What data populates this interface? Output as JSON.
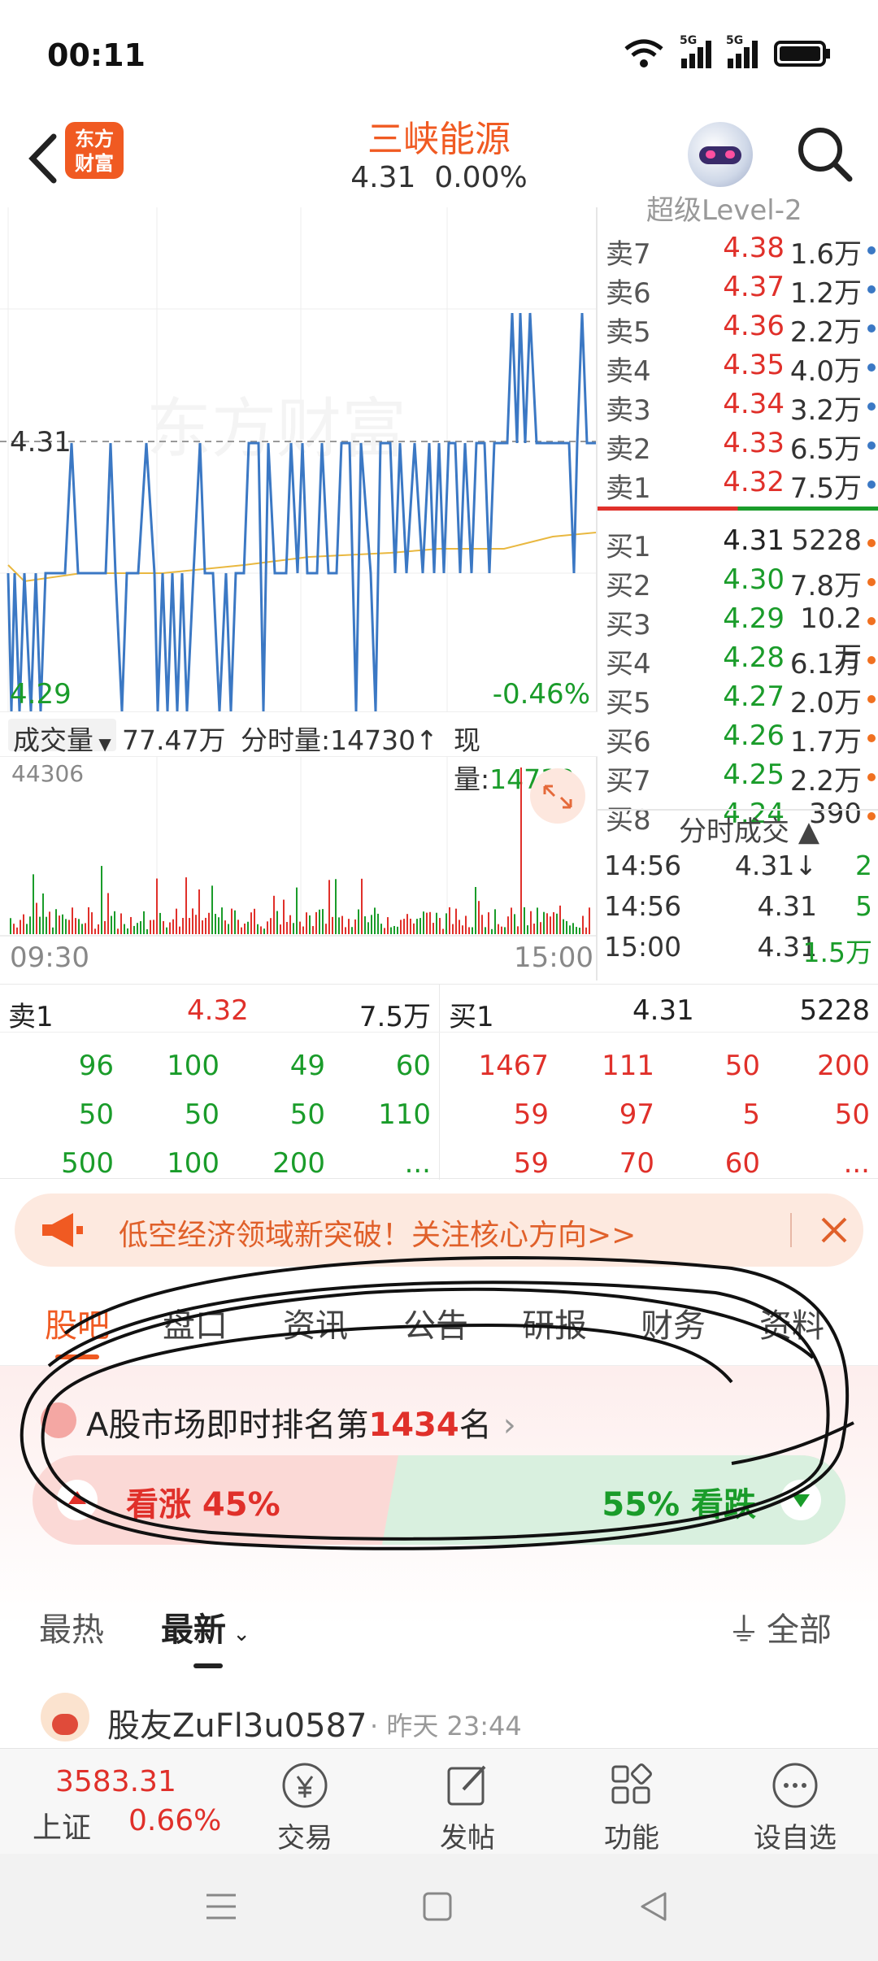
{
  "status": {
    "time": "00:11",
    "net1": "5G",
    "net2": "5G"
  },
  "header": {
    "logo_line1": "东方",
    "logo_line2": "财富",
    "stock_name": "三峡能源",
    "price": "4.31",
    "change": "0.00%"
  },
  "chart": {
    "ref_price": "4.31",
    "low_label": "4.29",
    "low_pct": "-0.46%",
    "watermark": "东方财富"
  },
  "orderbook": {
    "title": "超级Level-2",
    "sells": [
      {
        "label": "卖7",
        "price": "4.38",
        "vol": "1.6万"
      },
      {
        "label": "卖6",
        "price": "4.37",
        "vol": "1.2万"
      },
      {
        "label": "卖5",
        "price": "4.36",
        "vol": "2.2万"
      },
      {
        "label": "卖4",
        "price": "4.35",
        "vol": "4.0万"
      },
      {
        "label": "卖3",
        "price": "4.34",
        "vol": "3.2万"
      },
      {
        "label": "卖2",
        "price": "4.33",
        "vol": "6.5万"
      },
      {
        "label": "卖1",
        "price": "4.32",
        "vol": "7.5万"
      }
    ],
    "buys": [
      {
        "label": "买1",
        "price": "4.31",
        "vol": "5228"
      },
      {
        "label": "买2",
        "price": "4.30",
        "vol": "7.8万"
      },
      {
        "label": "买3",
        "price": "4.29",
        "vol": "10.2万"
      },
      {
        "label": "买4",
        "price": "4.28",
        "vol": "6.1万"
      },
      {
        "label": "买5",
        "price": "4.27",
        "vol": "2.0万"
      },
      {
        "label": "买6",
        "price": "4.26",
        "vol": "1.7万"
      },
      {
        "label": "买7",
        "price": "4.25",
        "vol": "2.2万"
      },
      {
        "label": "买8",
        "price": "4.24",
        "vol": "390"
      }
    ]
  },
  "volume_bar": {
    "selector": "成交量",
    "total": "77.47万",
    "fenshi": "分时量:14730↑",
    "now_label": "现量:",
    "now_val": "14730"
  },
  "vol_chart": {
    "max": "44306",
    "start_time": "09:30",
    "end_time": "15:00"
  },
  "ticks": {
    "title": "分时成交",
    "rows": [
      {
        "time": "14:56",
        "price": "4.31↓",
        "vol": "2"
      },
      {
        "time": "14:56",
        "price": "4.31",
        "vol": "5"
      },
      {
        "time": "15:00",
        "price": "4.31",
        "vol": "1.5万"
      }
    ]
  },
  "depth": {
    "sell_label": "卖1",
    "sell_price": "4.32",
    "sell_vol": "7.5万",
    "buy_label": "买1",
    "buy_price": "4.31",
    "buy_vol": "5228",
    "sell_rows": [
      [
        "96",
        "100",
        "49",
        "60"
      ],
      [
        "50",
        "50",
        "50",
        "110"
      ],
      [
        "500",
        "100",
        "200",
        "..."
      ]
    ],
    "buy_rows": [
      [
        "1467",
        "111",
        "50",
        "200"
      ],
      [
        "59",
        "97",
        "5",
        "50"
      ],
      [
        "59",
        "70",
        "60",
        "..."
      ]
    ]
  },
  "banner": {
    "text": "低空经济领域新突破！关注核心方向>>"
  },
  "tabs": [
    "股吧",
    "盘口",
    "资讯",
    "公告",
    "研报",
    "财务",
    "资料"
  ],
  "rank": {
    "prefix": "A股市场即时排名第",
    "number": "1434",
    "suffix": "名"
  },
  "vote": {
    "up_label": "看涨 45%",
    "down_label": "55% 看跌",
    "up_fraction": 0.45
  },
  "sort": {
    "hot": "最热",
    "new": "最新",
    "filter": "全部"
  },
  "post": {
    "user": "股友ZuFl3u0587",
    "time": "· 昨天 23:44"
  },
  "bottom_nav": {
    "index_value": "3583.31",
    "index_name": "上证",
    "index_change": "0.66%",
    "items": [
      "交易",
      "发帖",
      "功能",
      "设自选"
    ]
  },
  "colors": {
    "brand": "#f05a22",
    "up": "#e0302a",
    "down": "#1a9c2a",
    "line": "#3b78c4"
  }
}
